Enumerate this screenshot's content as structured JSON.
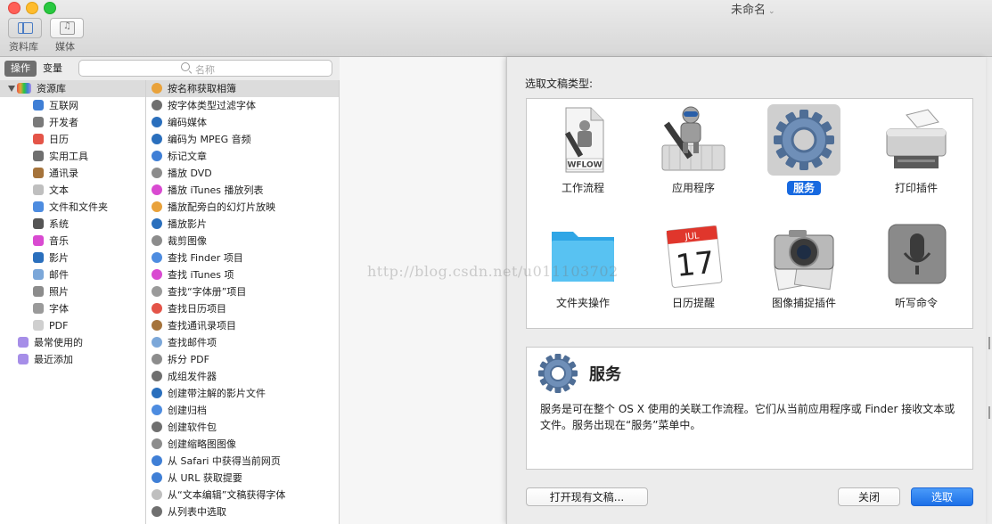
{
  "window": {
    "title": "未命名"
  },
  "toolbar": {
    "library_label": "资料库",
    "media_label": "媒体"
  },
  "left_pane": {
    "tab_actions": "操作",
    "tab_variables": "变量",
    "search_placeholder": "名称",
    "library_root": "资源库",
    "categories": [
      {
        "label": "互联网",
        "color": "#3f7fd6"
      },
      {
        "label": "开发者",
        "color": "#7a7a7a"
      },
      {
        "label": "日历",
        "color": "#e45448"
      },
      {
        "label": "实用工具",
        "color": "#6f6f6f"
      },
      {
        "label": "通讯录",
        "color": "#a5733b"
      },
      {
        "label": "文本",
        "color": "#bfbfbf"
      },
      {
        "label": "文件和文件夹",
        "color": "#4d8ce0"
      },
      {
        "label": "系统",
        "color": "#555555"
      },
      {
        "label": "音乐",
        "color": "#d94ad1"
      },
      {
        "label": "影片",
        "color": "#2a6fbd"
      },
      {
        "label": "邮件",
        "color": "#7ba7d9"
      },
      {
        "label": "照片",
        "color": "#8c8c8c"
      },
      {
        "label": "字体",
        "color": "#9a9a9a"
      },
      {
        "label": "PDF",
        "color": "#cfcfcf"
      }
    ],
    "smart": [
      {
        "label": "最常使用的",
        "color": "#a68ee8"
      },
      {
        "label": "最近添加",
        "color": "#a68ee8"
      }
    ],
    "actions": [
      {
        "label": "按名称获取相簿",
        "color": "#e9a23b"
      },
      {
        "label": "按字体类型过滤字体",
        "color": "#6f6f6f"
      },
      {
        "label": "编码媒体",
        "color": "#2a6fbd"
      },
      {
        "label": "编码为 MPEG 音频",
        "color": "#2a6fbd"
      },
      {
        "label": "标记文章",
        "color": "#3f7fd6"
      },
      {
        "label": "播放 DVD",
        "color": "#8c8c8c"
      },
      {
        "label": "播放 iTunes 播放列表",
        "color": "#d94ad1"
      },
      {
        "label": "播放配旁白的幻灯片放映",
        "color": "#e9a23b"
      },
      {
        "label": "播放影片",
        "color": "#2a6fbd"
      },
      {
        "label": "裁剪图像",
        "color": "#8c8c8c"
      },
      {
        "label": "查找 Finder 项目",
        "color": "#4d8ce0"
      },
      {
        "label": "查找 iTunes 项",
        "color": "#d94ad1"
      },
      {
        "label": "查找“字体册”项目",
        "color": "#9a9a9a"
      },
      {
        "label": "查找日历项目",
        "color": "#e45448"
      },
      {
        "label": "查找通讯录项目",
        "color": "#a5733b"
      },
      {
        "label": "查找邮件项",
        "color": "#7ba7d9"
      },
      {
        "label": "拆分 PDF",
        "color": "#8c8c8c"
      },
      {
        "label": "成组发件器",
        "color": "#6f6f6f"
      },
      {
        "label": "创建带注解的影片文件",
        "color": "#2a6fbd"
      },
      {
        "label": "创建归档",
        "color": "#4d8ce0"
      },
      {
        "label": "创建软件包",
        "color": "#6f6f6f"
      },
      {
        "label": "创建缩略图图像",
        "color": "#8c8c8c"
      },
      {
        "label": "从 Safari 中获得当前网页",
        "color": "#3f7fd6"
      },
      {
        "label": "从 URL 获取提要",
        "color": "#3f7fd6"
      },
      {
        "label": "从“文本编辑”文稿获得字体",
        "color": "#bfbfbf"
      },
      {
        "label": "从列表中选取",
        "color": "#6f6f6f"
      }
    ]
  },
  "sheet": {
    "title": "选取文稿类型:",
    "types": [
      {
        "label": "工作流程",
        "icon": "workflow-document-icon"
      },
      {
        "label": "应用程序",
        "icon": "automator-robot-icon"
      },
      {
        "label": "服务",
        "icon": "gear-icon"
      },
      {
        "label": "打印插件",
        "icon": "printer-icon"
      },
      {
        "label": "文件夹操作",
        "icon": "folder-icon"
      },
      {
        "label": "日历提醒",
        "icon": "calendar-icon"
      },
      {
        "label": "图像捕捉插件",
        "icon": "camera-icon"
      },
      {
        "label": "听写命令",
        "icon": "microphone-icon"
      }
    ],
    "workflow_badge": "WFLOW",
    "calendar_month": "JUL",
    "calendar_day": "17",
    "description_title": "服务",
    "description_text": "服务是可在整个 OS X 使用的关联工作流程。它们从当前应用程序或 Finder 接收文本或文件。服务出现在“服务”菜单中。",
    "open_button": "打开现有文稿...",
    "close_button": "关闭",
    "choose_button": "选取"
  },
  "watermark": "http://blog.csdn.net/u011103702",
  "colors": {
    "accent": "#1769e0",
    "selection": "#dcdcdc"
  }
}
